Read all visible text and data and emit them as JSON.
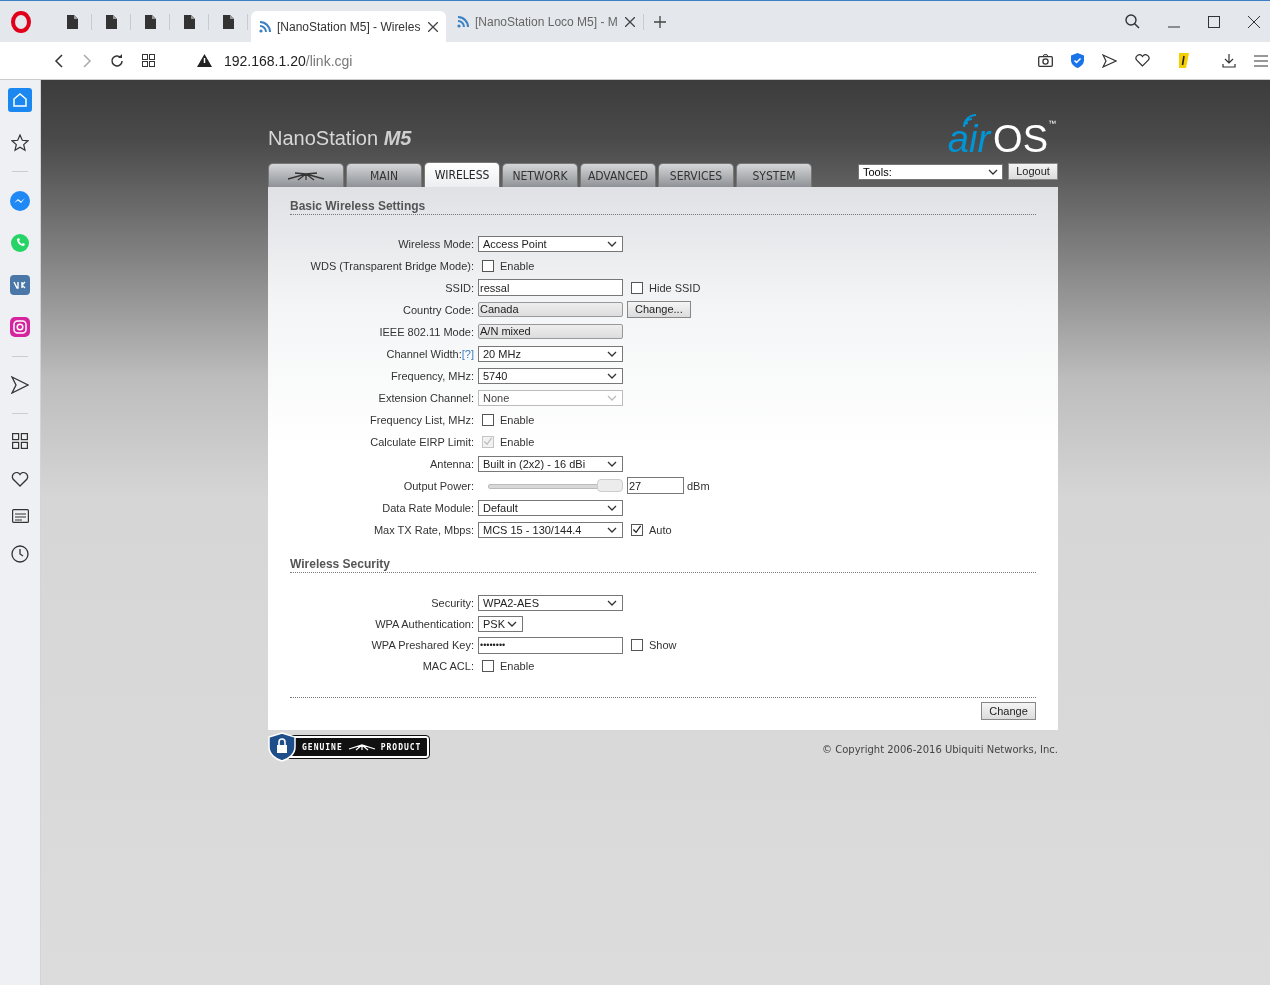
{
  "browser": {
    "tabs": [
      {
        "title": "[NanoStation M5] - Wireles",
        "selected": true
      },
      {
        "title": "[NanoStation Loco M5] - M",
        "selected": false
      }
    ],
    "address": {
      "host": "192.168.1.20",
      "path": "/link.cgi"
    }
  },
  "page": {
    "product": {
      "name": "NanoStation",
      "model": "M5"
    },
    "logo": {
      "prefix": "air",
      "suffix": "OS",
      "mark": "™"
    },
    "nav_tabs": [
      {
        "kind": "logo",
        "selected": false
      },
      {
        "kind": "text",
        "label": "MAIN",
        "selected": false
      },
      {
        "kind": "text",
        "label": "WIRELESS",
        "selected": true
      },
      {
        "kind": "text",
        "label": "NETWORK",
        "selected": false
      },
      {
        "kind": "text",
        "label": "ADVANCED",
        "selected": false
      },
      {
        "kind": "text",
        "label": "SERVICES",
        "selected": false
      },
      {
        "kind": "text",
        "label": "SYSTEM",
        "selected": false
      }
    ],
    "tools": {
      "value": "Tools:"
    },
    "logout": "Logout",
    "sections": [
      {
        "title": "Basic Wireless Settings",
        "fields": [
          {
            "kind": "select",
            "label": "Wireless Mode:",
            "value": "Access Point",
            "disabled": false
          },
          {
            "kind": "checkbox",
            "label": "WDS (Transparent Bridge Mode):",
            "text": "Enable",
            "checked": false,
            "disabled": false
          },
          {
            "kind": "text",
            "label": "SSID:",
            "value": "ressal",
            "extra": {
              "text": "Hide SSID",
              "checked": false
            }
          },
          {
            "kind": "readonly",
            "label": "Country Code:",
            "value": "Canada",
            "disabled": false,
            "button": "Change..."
          },
          {
            "kind": "readonly",
            "label": "IEEE 802.11 Mode:",
            "value": "A/N mixed",
            "disabled": false
          },
          {
            "kind": "select",
            "label": "Channel Width:",
            "help": "[?]",
            "value": "20 MHz",
            "disabled": false
          },
          {
            "kind": "select",
            "label": "Frequency, MHz:",
            "value": "5740",
            "disabled": false
          },
          {
            "kind": "select",
            "label": "Extension Channel:",
            "value": "None",
            "disabled": true
          },
          {
            "kind": "checkbox",
            "label": "Frequency List, MHz:",
            "text": "Enable",
            "checked": false,
            "disabled": false
          },
          {
            "kind": "checkbox",
            "label": "Calculate EIRP Limit:",
            "text": "Enable",
            "checked": true,
            "disabled": true
          },
          {
            "kind": "select",
            "label": "Antenna:",
            "value": "Built in (2x2) - 16 dBi",
            "disabled": false
          },
          {
            "kind": "slider",
            "label": "Output Power:",
            "level": 1,
            "value": "27",
            "unit": "dBm"
          },
          {
            "kind": "select",
            "label": "Data Rate Module:",
            "value": "Default",
            "disabled": false
          },
          {
            "kind": "select",
            "label": "Max TX Rate, Mbps:",
            "value": "MCS 15 - 130/144.4",
            "disabled": false,
            "extra": {
              "text": "Auto",
              "checked": true
            }
          }
        ]
      },
      {
        "title": "Wireless Security",
        "fields": [
          {
            "kind": "select",
            "label": "Security:",
            "value": "WPA2-AES",
            "disabled": false
          },
          {
            "kind": "small_select",
            "label": "WPA Authentication:",
            "value": "PSK",
            "disabled": false
          },
          {
            "kind": "password",
            "label": "WPA Preshared Key:",
            "value": "••••••••",
            "extra": {
              "text": "Show",
              "checked": false
            }
          },
          {
            "kind": "checkbox",
            "label": "MAC ACL:",
            "text": "Enable",
            "checked": false,
            "disabled": false
          }
        ]
      }
    ],
    "submit": "Change",
    "badge": {
      "left": "GENUINE",
      "right": "PRODUCT"
    },
    "copyright": "© Copyright 2006-2016 Ubiquiti Networks, Inc."
  }
}
